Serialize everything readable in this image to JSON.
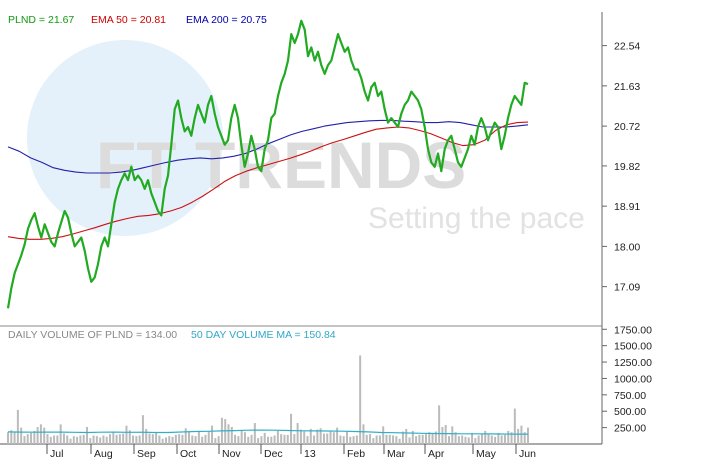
{
  "legend": {
    "price": "PLND = 21.67",
    "ema50": "EMA 50 = 20.81",
    "ema200": "EMA 200 = 20.75",
    "volume": "DAILY VOLUME OF PLND = 134.00",
    "volume_ma": "50 DAY VOLUME MA = 150.84"
  },
  "watermark": {
    "logo": "FT TRENDS",
    "tagline": "Setting the pace"
  },
  "colors": {
    "price": "#22aa22",
    "ema50": "#cc1111",
    "ema200": "#2222aa",
    "volume_bars": "#bbbbbb",
    "volume_ma": "#30b0c8",
    "legend_price": "#119911",
    "legend_ema50": "#cc0000",
    "legend_ema200": "#0000aa",
    "legend_volume": "#888888",
    "legend_volume_ma": "#30a8c8",
    "watermark_circle": "#e4f1fa",
    "watermark_text": "#dcdcdc"
  },
  "chart_data": [
    {
      "type": "line",
      "x_months": [
        "Jul",
        "Aug",
        "Sep",
        "Oct",
        "Nov",
        "Dec",
        "13",
        "Feb",
        "Mar",
        "Apr",
        "May",
        "Jun"
      ],
      "y_ticks": [
        17.09,
        18.0,
        18.91,
        19.82,
        20.72,
        21.63,
        22.54
      ],
      "ylim": [
        16.2,
        23.3
      ],
      "series": [
        {
          "name": "PLND",
          "values": [
            16.6,
            17.05,
            17.4,
            17.6,
            17.8,
            18.05,
            18.4,
            18.6,
            18.75,
            18.45,
            18.2,
            18.5,
            18.3,
            18.1,
            18.0,
            18.3,
            18.55,
            18.8,
            18.65,
            18.3,
            18.0,
            18.1,
            18.2,
            17.9,
            17.5,
            17.2,
            17.3,
            17.6,
            18.0,
            18.2,
            18.0,
            18.5,
            19.0,
            19.3,
            19.5,
            19.65,
            19.5,
            19.8,
            19.5,
            19.6,
            19.5,
            19.3,
            19.5,
            19.2,
            19.0,
            18.8,
            18.7,
            19.3,
            19.6,
            20.3,
            21.1,
            21.3,
            20.9,
            20.6,
            20.7,
            20.5,
            20.9,
            21.2,
            21.0,
            20.8,
            21.2,
            21.4,
            21.0,
            20.7,
            20.5,
            20.3,
            20.4,
            20.9,
            21.2,
            20.9,
            20.3,
            19.8,
            20.1,
            20.5,
            20.2,
            19.8,
            19.7,
            20.2,
            20.4,
            20.9,
            21.0,
            21.4,
            21.7,
            21.9,
            22.2,
            22.8,
            22.6,
            22.8,
            23.1,
            22.9,
            22.3,
            22.5,
            22.2,
            22.4,
            22.1,
            21.9,
            22.1,
            22.2,
            22.5,
            22.8,
            22.6,
            22.4,
            22.5,
            22.2,
            22.0,
            22.0,
            21.8,
            21.5,
            21.3,
            21.6,
            21.7,
            21.4,
            21.5,
            21.1,
            20.8,
            20.9,
            20.8,
            20.7,
            21.0,
            21.2,
            21.3,
            21.5,
            21.4,
            21.3,
            21.1,
            20.7,
            20.2,
            19.9,
            19.8,
            20.1,
            19.7,
            20.2,
            20.4,
            20.5,
            20.2,
            19.9,
            19.8,
            20.0,
            20.2,
            20.5,
            20.3,
            20.7,
            20.9,
            20.7,
            20.4,
            20.6,
            20.8,
            20.7,
            20.2,
            20.5,
            20.9,
            21.2,
            21.4,
            21.3,
            21.2,
            21.7,
            21.67
          ],
          "color": "#22aa22"
        },
        {
          "name": "EMA 50",
          "values": [
            18.22,
            18.18,
            18.16,
            18.16,
            18.18,
            18.22,
            18.28,
            18.35,
            18.42,
            18.5,
            18.57,
            18.63,
            18.68,
            18.7,
            18.74,
            18.8,
            18.88,
            19.0,
            19.14,
            19.3,
            19.47,
            19.6,
            19.7,
            19.78,
            19.85,
            19.92,
            19.99,
            20.07,
            20.16,
            20.26,
            20.35,
            20.42,
            20.5,
            20.58,
            20.65,
            20.68,
            20.7,
            20.68,
            20.62,
            20.55,
            20.45,
            20.35,
            20.28,
            20.3,
            20.4,
            20.62,
            20.75,
            20.8,
            20.81
          ],
          "color": "#cc1111"
        },
        {
          "name": "EMA 200",
          "values": [
            20.25,
            20.15,
            20.0,
            19.9,
            19.78,
            19.72,
            19.68,
            19.66,
            19.66,
            19.66,
            19.68,
            19.72,
            19.78,
            19.84,
            19.9,
            19.95,
            19.98,
            20.0,
            19.98,
            20.0,
            20.04,
            20.1,
            20.2,
            20.32,
            20.42,
            20.52,
            20.6,
            20.66,
            20.72,
            20.76,
            20.8,
            20.82,
            20.84,
            20.85,
            20.85,
            20.83,
            20.82,
            20.8,
            20.8,
            20.82,
            20.8,
            20.75,
            20.7,
            20.7,
            20.7,
            20.72,
            20.75
          ],
          "color": "#2222aa"
        }
      ]
    },
    {
      "type": "bar",
      "y_ticks": [
        "250.00",
        "500.00",
        "750.00",
        "1000.00",
        "1250.00",
        "1500.00",
        "1750.00"
      ],
      "ylim": [
        0,
        1800
      ],
      "series": [
        {
          "name": "DAILY VOLUME OF PLND",
          "values": [
            180,
            210,
            180,
            520,
            250,
            120,
            150,
            170,
            200,
            260,
            300,
            250,
            150,
            110,
            130,
            130,
            300,
            160,
            130,
            80,
            120,
            110,
            130,
            140,
            260,
            90,
            130,
            120,
            100,
            130,
            110,
            150,
            190,
            140,
            150,
            160,
            280,
            210,
            130,
            120,
            130,
            440,
            230,
            160,
            150,
            180,
            130,
            80,
            100,
            120,
            110,
            140,
            150,
            140,
            240,
            190,
            130,
            120,
            200,
            110,
            140,
            190,
            280,
            90,
            120,
            400,
            380,
            300,
            260,
            140,
            120,
            200,
            180,
            110,
            140,
            320,
            90,
            120,
            170,
            110,
            110,
            130,
            200,
            150,
            140,
            140,
            460,
            150,
            320,
            220,
            190,
            120,
            230,
            130,
            220,
            240,
            160,
            160,
            190,
            180,
            250,
            130,
            120,
            190,
            110,
            120,
            130,
            1350,
            300,
            140,
            150,
            90,
            130,
            130,
            270,
            140,
            140,
            130,
            120,
            80,
            190,
            230,
            100,
            200,
            120,
            140,
            140,
            150,
            180,
            170,
            190,
            590,
            260,
            290,
            120,
            270,
            180,
            120,
            130,
            110,
            100,
            170,
            90,
            130,
            150,
            200,
            150,
            130,
            110,
            170,
            130,
            140,
            200,
            180,
            540,
            230,
            280,
            180,
            250
          ],
          "color": "#bbbbbb"
        },
        {
          "name": "50 DAY VOLUME MA",
          "values": [
            185,
            182,
            180,
            182,
            182,
            178,
            176,
            180,
            182,
            178,
            180,
            176,
            176,
            183,
            190,
            193,
            200,
            205,
            210,
            212,
            210,
            206,
            202,
            200,
            198,
            195,
            190,
            184,
            176,
            172,
            168,
            163,
            160,
            158,
            156,
            155,
            154,
            152,
            151,
            151
          ],
          "color": "#30b0c8"
        }
      ]
    }
  ]
}
